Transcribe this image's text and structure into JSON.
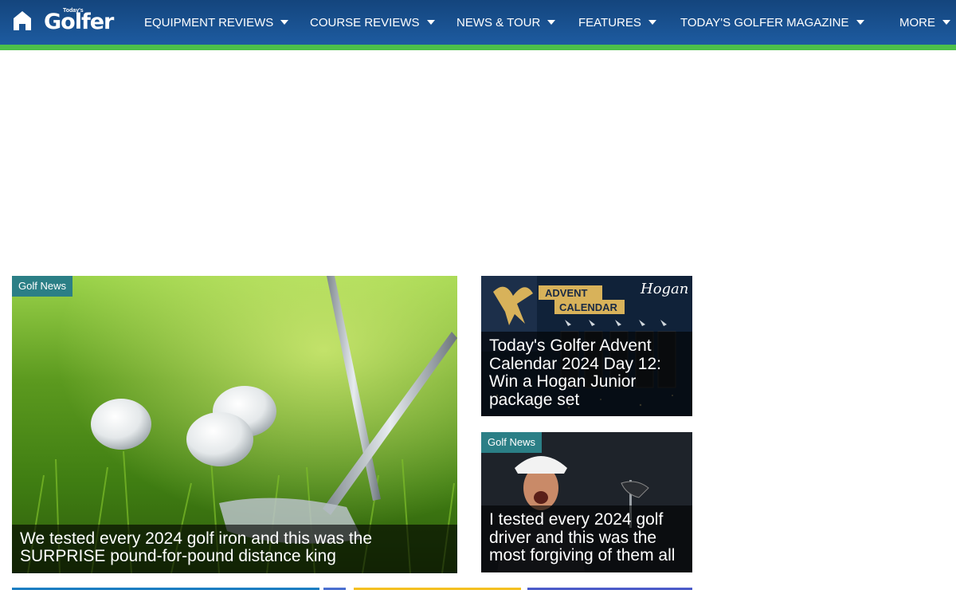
{
  "header": {
    "logo_small": "Today's",
    "logo_text": "Golfer",
    "nav": [
      {
        "label": "EQUIPMENT REVIEWS"
      },
      {
        "label": "COURSE REVIEWS"
      },
      {
        "label": "NEWS & TOUR"
      },
      {
        "label": "FEATURES"
      },
      {
        "label": "TODAY'S GOLFER MAGAZINE"
      },
      {
        "label": "MORE"
      }
    ]
  },
  "articles": {
    "featured": {
      "tag": "Golf News",
      "title": "We tested every 2024 golf iron and this was the SURPRISE pound-for-pound distance king"
    },
    "side1": {
      "image_text_1": "ADVENT",
      "image_text_2": "CALENDAR",
      "brand": "Hogan",
      "title": "Today's Golfer Advent Calendar 2024 Day 12: Win a Hogan Junior package set"
    },
    "side2": {
      "tag": "Golf News",
      "title": "I tested every 2024 golf driver and this was the most forgiving of them all"
    }
  },
  "colors": {
    "header_blue": "#1d5ba0",
    "accent_green": "#4cc04a",
    "tag_teal": "#2b7f86"
  }
}
